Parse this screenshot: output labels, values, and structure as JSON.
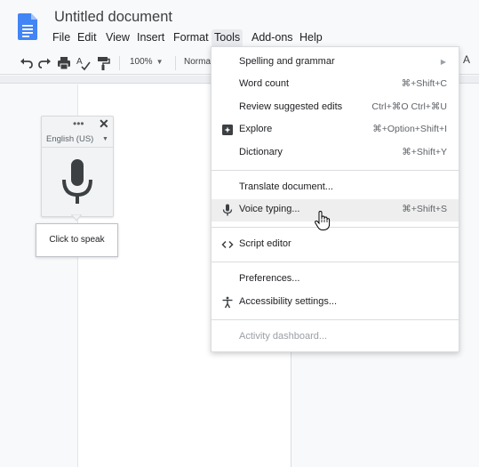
{
  "doc": {
    "title": "Untitled document",
    "icon": "docs-file-icon",
    "brand_color": "#4285f4"
  },
  "menubar": {
    "items": [
      {
        "label": "File",
        "active": false
      },
      {
        "label": "Edit",
        "active": false
      },
      {
        "label": "View",
        "active": false
      },
      {
        "label": "Insert",
        "active": false
      },
      {
        "label": "Format",
        "active": false
      },
      {
        "label": "Tools",
        "active": true
      },
      {
        "label": "Add-ons",
        "active": false
      },
      {
        "label": "Help",
        "active": false
      }
    ]
  },
  "toolbar": {
    "icons": [
      "undo-icon",
      "redo-icon",
      "print-icon",
      "spellcheck-icon",
      "paint-format-icon"
    ],
    "zoom": "100%",
    "style": "Normal",
    "text_color_label": "A"
  },
  "voice_widget": {
    "dots": "•••",
    "close": "✕",
    "language": "English (US)",
    "mic_icon": "microphone-icon",
    "tooltip": "Click to speak"
  },
  "tools_menu": {
    "items": [
      {
        "label": "Spelling and grammar",
        "shortcut": "",
        "submenu": true,
        "icon": ""
      },
      {
        "label": "Word count",
        "shortcut": "⌘+Shift+C",
        "submenu": false,
        "icon": ""
      },
      {
        "label": "Review suggested edits",
        "shortcut": "Ctrl+⌘O Ctrl+⌘U",
        "submenu": false,
        "icon": ""
      },
      {
        "label": "Explore",
        "shortcut": "⌘+Option+Shift+I",
        "submenu": false,
        "icon": "explore-icon"
      },
      {
        "label": "Dictionary",
        "shortcut": "⌘+Shift+Y",
        "submenu": false,
        "icon": ""
      },
      {
        "label": "Translate document...",
        "shortcut": "",
        "submenu": false,
        "icon": ""
      },
      {
        "label": "Voice typing...",
        "shortcut": "⌘+Shift+S",
        "submenu": false,
        "icon": "microphone-icon",
        "hovered": true
      },
      {
        "label": "Script editor",
        "shortcut": "",
        "submenu": false,
        "icon": "code-icon"
      },
      {
        "label": "Preferences...",
        "shortcut": "",
        "submenu": false,
        "icon": ""
      },
      {
        "label": "Accessibility settings...",
        "shortcut": "",
        "submenu": false,
        "icon": "accessibility-icon"
      },
      {
        "label": "Activity dashboard...",
        "shortcut": "",
        "submenu": false,
        "icon": "",
        "disabled": true
      }
    ]
  }
}
